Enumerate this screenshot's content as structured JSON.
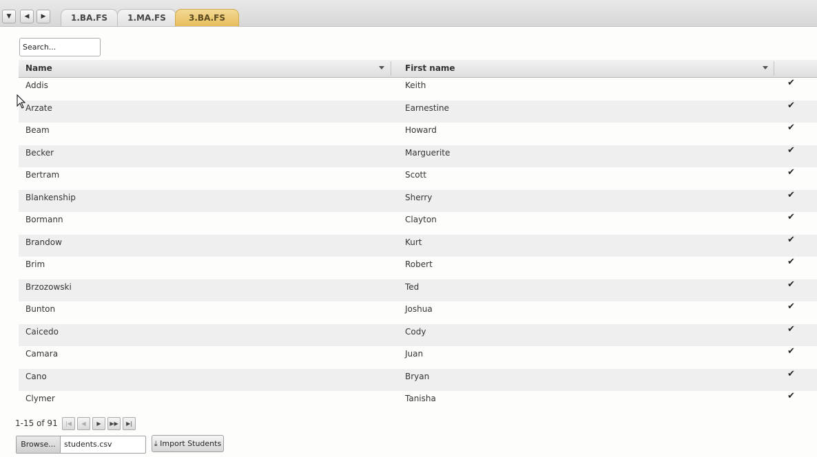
{
  "nav": {
    "menu_icon": "chevron-down-icon",
    "back_icon": "chevron-left-icon",
    "forward_icon": "chevron-right-icon"
  },
  "tabs": [
    {
      "label": "1.BA.FS",
      "active": false
    },
    {
      "label": "1.MA.FS",
      "active": false
    },
    {
      "label": "3.BA.FS",
      "active": true
    }
  ],
  "search": {
    "placeholder": "Search..."
  },
  "table": {
    "columns": [
      "Name",
      "First name"
    ],
    "rows": [
      {
        "name": "Addis",
        "first_name": "Keith",
        "checked": true
      },
      {
        "name": "Arzate",
        "first_name": "Earnestine",
        "checked": true
      },
      {
        "name": "Beam",
        "first_name": "Howard",
        "checked": true
      },
      {
        "name": "Becker",
        "first_name": "Marguerite",
        "checked": true
      },
      {
        "name": "Bertram",
        "first_name": "Scott",
        "checked": true
      },
      {
        "name": "Blankenship",
        "first_name": "Sherry",
        "checked": true
      },
      {
        "name": "Bormann",
        "first_name": "Clayton",
        "checked": true
      },
      {
        "name": "Brandow",
        "first_name": "Kurt",
        "checked": true
      },
      {
        "name": "Brim",
        "first_name": "Robert",
        "checked": true
      },
      {
        "name": "Brzozowski",
        "first_name": "Ted",
        "checked": true
      },
      {
        "name": "Bunton",
        "first_name": "Joshua",
        "checked": true
      },
      {
        "name": "Caicedo",
        "first_name": "Cody",
        "checked": true
      },
      {
        "name": "Camara",
        "first_name": "Juan",
        "checked": true
      },
      {
        "name": "Cano",
        "first_name": "Bryan",
        "checked": true
      },
      {
        "name": "Clymer",
        "first_name": "Tanisha",
        "checked": true
      }
    ]
  },
  "pager": {
    "range_text": "1-15 of 91"
  },
  "upload": {
    "browse_label": "Browse...",
    "file_name": "students.csv",
    "import_label": "Import Students"
  },
  "colors": {
    "active_tab": "#e6bd5b",
    "row_alt": "#efefef"
  }
}
